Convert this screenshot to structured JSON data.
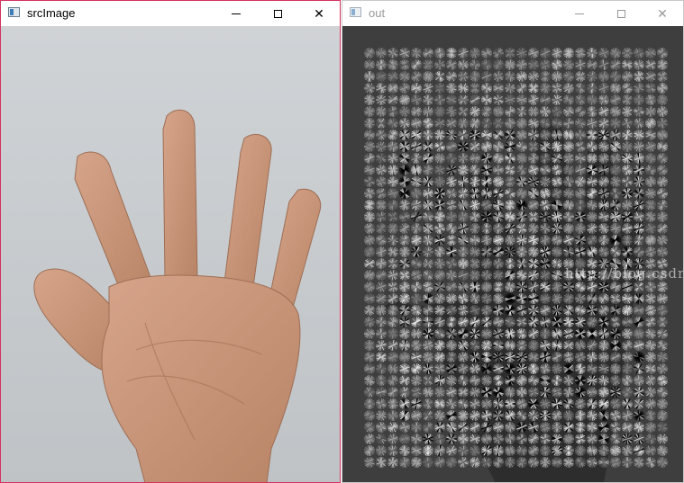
{
  "windows": {
    "src": {
      "title": "srcImage"
    },
    "out": {
      "title": "out"
    }
  },
  "controls": {
    "minimize_icon": "minimize-icon",
    "maximize_icon": "maximize-icon",
    "close_icon": "close-icon",
    "close_glyph": "✕"
  },
  "watermark": "http://blog.csdn.net/masaifei",
  "colors": {
    "active_border": "#d2335f",
    "inactive_title": "#9a9a9a",
    "hog_background": "#3e3e3e"
  }
}
